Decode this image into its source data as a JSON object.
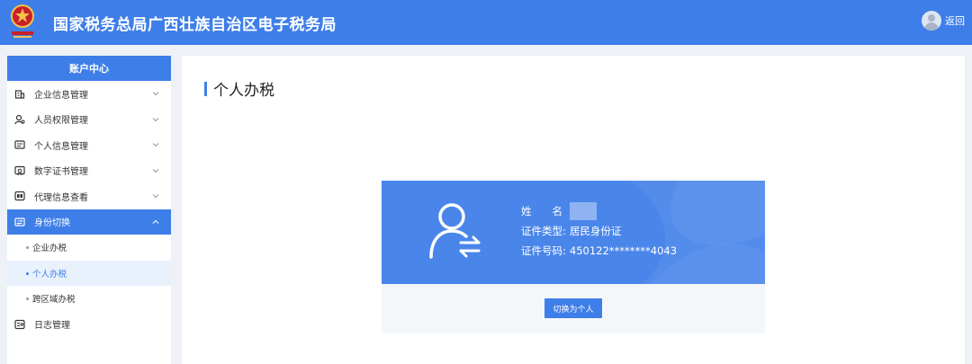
{
  "header": {
    "title": "国家税务总局广西壮族自治区电子税务局",
    "back_label": "返回",
    "emblem_icon": "tax-emblem-icon",
    "avatar_icon": "user-avatar-icon"
  },
  "sidebar": {
    "title": "账户中心",
    "items": [
      {
        "label": "企业信息管理",
        "icon": "building-icon"
      },
      {
        "label": "人员权限管理",
        "icon": "user-permission-icon"
      },
      {
        "label": "个人信息管理",
        "icon": "profile-card-icon"
      },
      {
        "label": "数字证书管理",
        "icon": "certificate-icon"
      },
      {
        "label": "代理信息查看",
        "icon": "agent-icon"
      },
      {
        "label": "身份切换",
        "icon": "identity-switch-icon"
      }
    ],
    "sub_items": [
      {
        "label": "企业办税"
      },
      {
        "label": "个人办税"
      },
      {
        "label": "跨区域办税"
      }
    ],
    "log_item": {
      "label": "日志管理",
      "icon": "log-icon"
    }
  },
  "main": {
    "title": "个人办税",
    "card": {
      "name_label": "姓　　名",
      "id_type_label": "证件类型:",
      "id_type_value": "居民身份证",
      "id_number_label": "证件号码:",
      "id_number_value": "450122********4043",
      "button_label": "切换为个人"
    }
  },
  "colors": {
    "primary": "#3e7ee8",
    "card_blue": "#4a86ea",
    "selected_bg": "#e8f1fc",
    "page_bg": "#eef1f6"
  }
}
